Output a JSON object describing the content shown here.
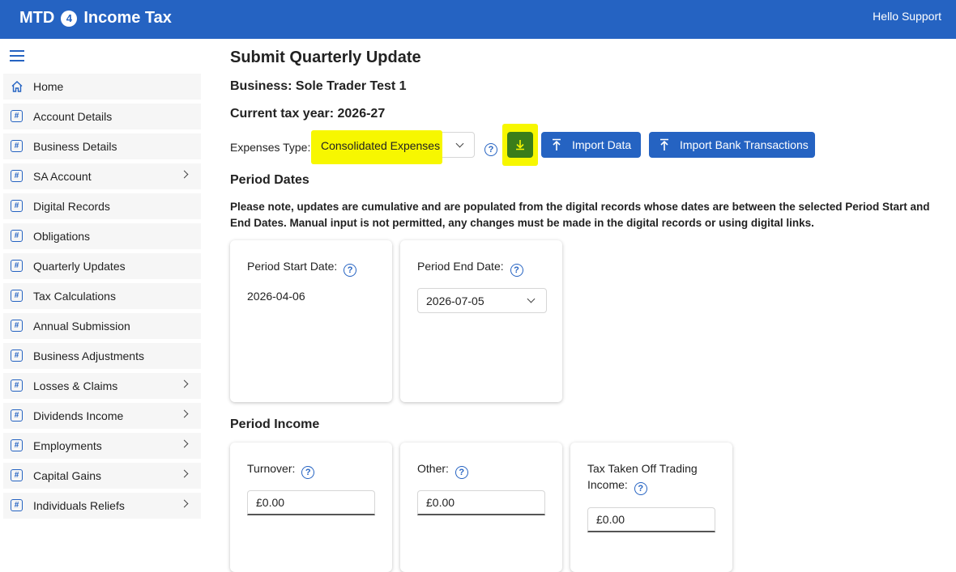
{
  "header": {
    "brand_left": "MTD",
    "brand_badge": "4",
    "brand_right": "Income Tax",
    "greeting": "Hello Support"
  },
  "sidebar": {
    "items": [
      {
        "label": "Home",
        "icon": "home-icon",
        "submenu": false
      },
      {
        "label": "Account Details",
        "icon": "hash-icon",
        "submenu": false
      },
      {
        "label": "Business Details",
        "icon": "hash-icon",
        "submenu": false
      },
      {
        "label": "SA Account",
        "icon": "hash-icon",
        "submenu": true
      },
      {
        "label": "Digital Records",
        "icon": "hash-icon",
        "submenu": false
      },
      {
        "label": "Obligations",
        "icon": "hash-icon",
        "submenu": false
      },
      {
        "label": "Quarterly Updates",
        "icon": "hash-icon",
        "submenu": false
      },
      {
        "label": "Tax Calculations",
        "icon": "hash-icon",
        "submenu": false
      },
      {
        "label": "Annual Submission",
        "icon": "hash-icon",
        "submenu": false
      },
      {
        "label": "Business Adjustments",
        "icon": "hash-icon",
        "submenu": false
      },
      {
        "label": "Losses & Claims",
        "icon": "hash-icon",
        "submenu": true
      },
      {
        "label": "Dividends Income",
        "icon": "hash-icon",
        "submenu": true
      },
      {
        "label": "Employments",
        "icon": "hash-icon",
        "submenu": true
      },
      {
        "label": "Capital Gains",
        "icon": "hash-icon",
        "submenu": true
      },
      {
        "label": "Individuals Reliefs",
        "icon": "hash-icon",
        "submenu": true
      }
    ]
  },
  "main": {
    "title": "Submit Quarterly Update",
    "business": "Business: Sole Trader Test 1",
    "tax_year": "Current tax year: 2026-27",
    "expenses": {
      "label": "Expenses Type:",
      "value": "Consolidated Expenses"
    },
    "help_glyph": "?",
    "buttons": {
      "import_data": "Import Data",
      "import_bank": "Import Bank Transactions"
    },
    "period_dates": {
      "title": "Period Dates",
      "note": "Please note, updates are cumulative and are populated from the digital records whose dates are between the selected Period Start and End Dates. Manual input is not permitted, any changes must be made in the digital records or using digital links.",
      "start_label": "Period Start Date:",
      "start_value": "2026-04-06",
      "end_label": "Period End Date:",
      "end_value": "2026-07-05"
    },
    "period_income": {
      "title": "Period Income",
      "turnover_label": "Turnover:",
      "turnover_value": "£0.00",
      "other_label": "Other:",
      "other_value": "£0.00",
      "tax_taken_label": "Tax Taken Off Trading Income:",
      "tax_taken_value": "£0.00"
    }
  },
  "colors": {
    "brand": "#2563c2",
    "download_button": "#3a7d1a",
    "highlight": "#f7f700"
  }
}
